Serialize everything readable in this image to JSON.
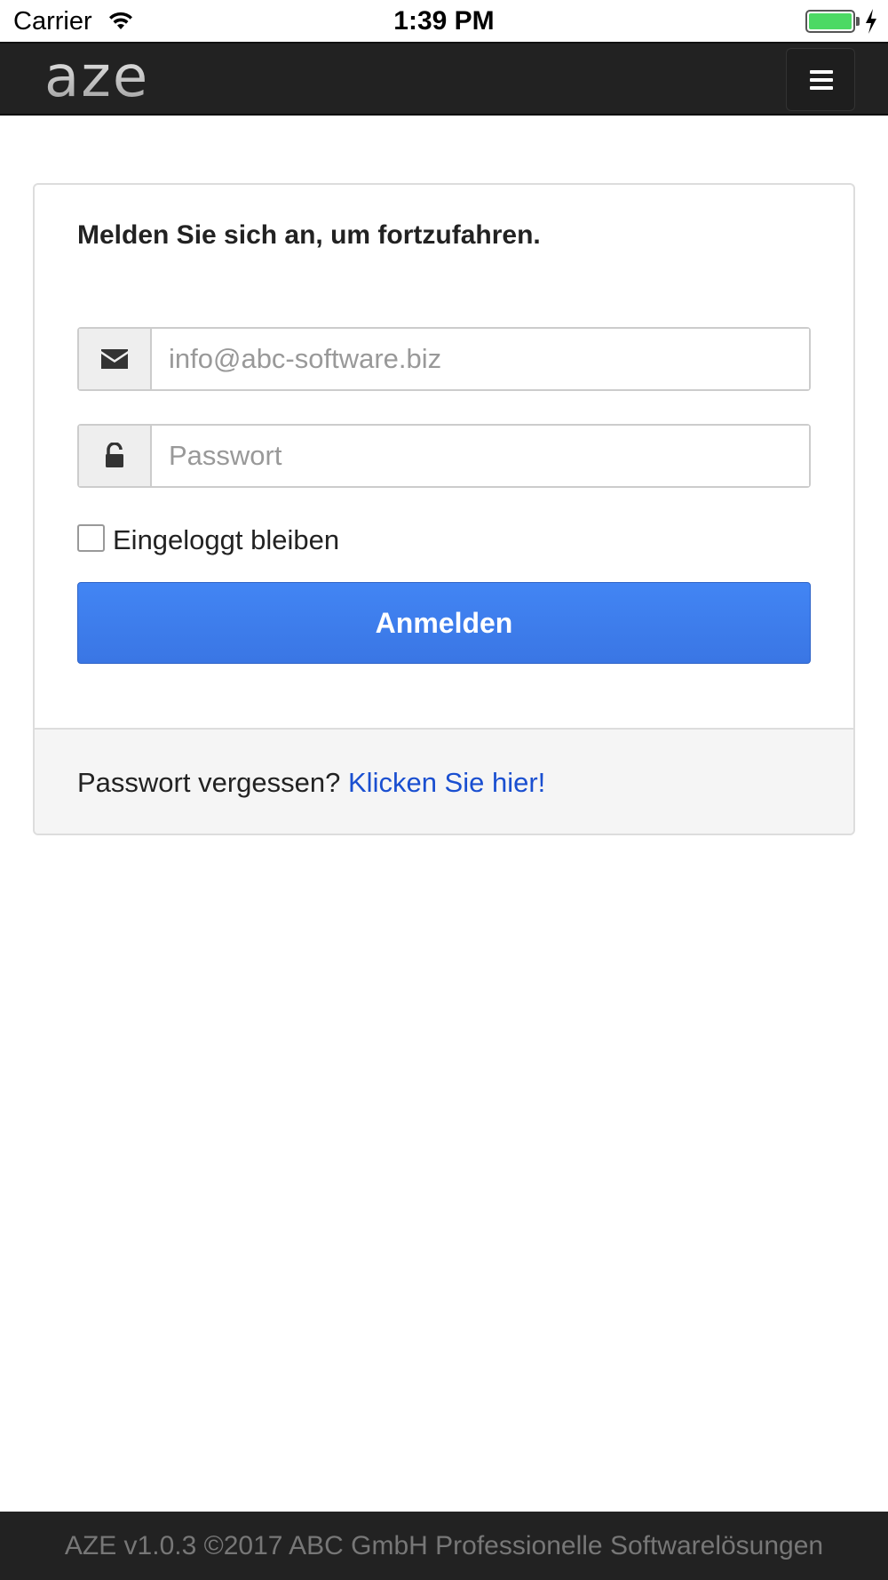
{
  "status_bar": {
    "carrier": "Carrier",
    "time": "1:39 PM",
    "battery_level": 1.0,
    "battery_color": "#4cd964"
  },
  "navbar": {
    "brand": "aze",
    "menu_icon": "hamburger-icon",
    "background": "#222222"
  },
  "login_panel": {
    "heading": "Melden Sie sich an, um fortzufahren.",
    "email": {
      "icon": "envelope-icon",
      "placeholder": "info@abc-software.biz",
      "value": ""
    },
    "password": {
      "icon": "unlock-icon",
      "placeholder": "Passwort",
      "value": ""
    },
    "remember_me": {
      "label": "Eingeloggt bleiben",
      "checked": false
    },
    "submit_label": "Anmelden",
    "submit_color": "#4285f4",
    "forgot": {
      "text": "Passwort vergessen?",
      "link_text": "Klicken Sie hier!",
      "link_color": "#1a4fd0"
    }
  },
  "page_footer": {
    "text": "AZE v1.0.3 ©2017 ABC GmbH Professionelle Softwarelösungen"
  }
}
